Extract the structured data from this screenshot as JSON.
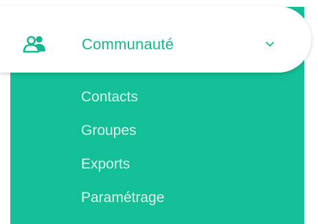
{
  "menu": {
    "section": {
      "label": "Communauté",
      "icon": "community-users-icon",
      "expand_icon": "chevron-down-icon"
    },
    "items": [
      {
        "label": "Contacts"
      },
      {
        "label": "Groupes"
      },
      {
        "label": "Exports"
      },
      {
        "label": "Paramétrage"
      }
    ]
  },
  "colors": {
    "accent_green": "#12bf97",
    "header_background": "#ffffff",
    "submenu_text": "#d8f5ec"
  }
}
